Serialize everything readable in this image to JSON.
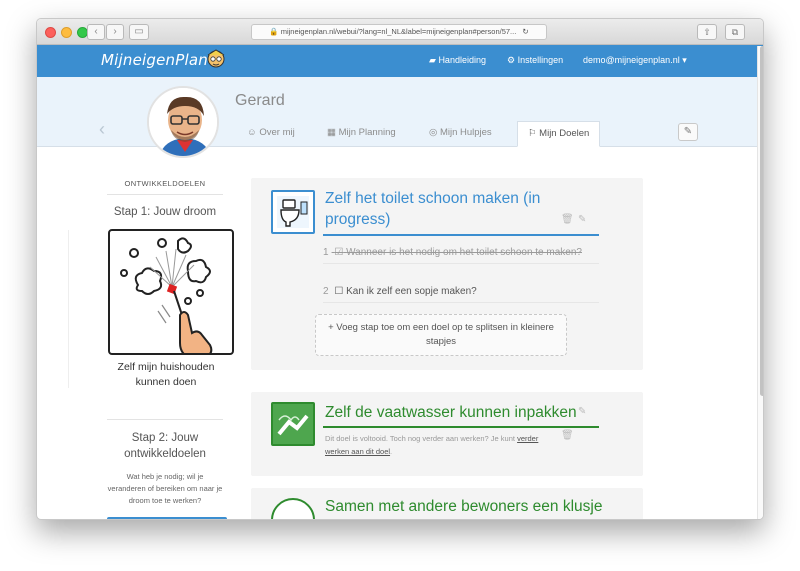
{
  "browser": {
    "url": "mijneigenplan.nl/webui/?lang=nl_NL&label=mijneigenplan#person/57..."
  },
  "navbar": {
    "logo_text": "MijneigenPlan",
    "manual_label": "Handleiding",
    "settings_label": "Instellingen",
    "user_email": "demo@mijneigenplan.nl",
    "brand_color": "#3b8ed0"
  },
  "profile": {
    "name": "Gerard",
    "tabs": [
      {
        "label": "Over mij",
        "icon": "user-circle-icon"
      },
      {
        "label": "Mijn Planning",
        "icon": "calendar-icon"
      },
      {
        "label": "Mijn Hulpjes",
        "icon": "lifebuoy-icon"
      },
      {
        "label": "Mijn Doelen",
        "icon": "flag-icon",
        "active": true
      }
    ]
  },
  "sidebar": {
    "heading": "ONTWIKKELDOELEN",
    "step1_title": "Stap 1: Jouw droom",
    "dream_text": "Zelf mijn huishouden kunnen doen",
    "step2_title": "Stap 2: Jouw ontwikkeldoelen",
    "step2_sub": "Wat heb je nodig; wil je veranderen of bereiken om naar je droom toe te werken?"
  },
  "goals": [
    {
      "title": "Zelf het toilet schoon maken (in progress)",
      "color": "#3b8ed0",
      "icon": "toilet-icon",
      "steps": [
        {
          "num": "1",
          "text": "Wanneer is het nodig om het toilet schoon te maken?",
          "done": true
        },
        {
          "num": "2",
          "text": "Kan ik zelf een sopje maken?",
          "done": false
        }
      ],
      "add_step_label": "Voeg stap toe om een doel op te splitsen in kleinere stapjes"
    },
    {
      "title": "Zelf de vaatwasser kunnen inpakken",
      "color": "#2e8b2e",
      "icon": "dishwasher-icon",
      "done_note": "Dit doel is voltooid. Toch nog verder aan werken? Je kunt",
      "done_link": "verder werken aan dit doel"
    },
    {
      "title": "Samen met andere bewoners een klusje",
      "color": "#2e8b2e",
      "icon": "check-circle-icon"
    }
  ]
}
